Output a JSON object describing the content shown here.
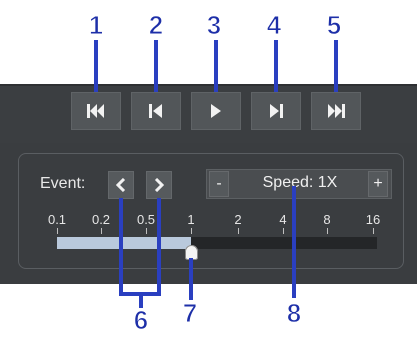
{
  "toolbar": {
    "buttons": [
      {
        "name": "skip-to-start",
        "icon": "skip-to-start-icon"
      },
      {
        "name": "previous-frame",
        "icon": "step-back-icon"
      },
      {
        "name": "play",
        "icon": "play-icon"
      },
      {
        "name": "next-frame",
        "icon": "step-forward-icon"
      },
      {
        "name": "skip-to-end",
        "icon": "skip-to-end-icon"
      }
    ]
  },
  "event": {
    "label": "Event:",
    "prev_glyph": "‹",
    "next_glyph": "›"
  },
  "speed": {
    "minus_label": "-",
    "label": "Speed: 1X",
    "plus_label": "+"
  },
  "slider": {
    "ticks": [
      "0.1",
      "0.2",
      "0.5",
      "1",
      "2",
      "4",
      "8",
      "16"
    ],
    "current_value": "1"
  },
  "callouts": [
    "1",
    "2",
    "3",
    "4",
    "5",
    "6",
    "7",
    "8"
  ],
  "colors": {
    "panel_bg": "#3a3d40",
    "button_bg": "#525659",
    "annotation_blue": "#2a3fc0",
    "slider_fill": "#b9c9dc"
  }
}
